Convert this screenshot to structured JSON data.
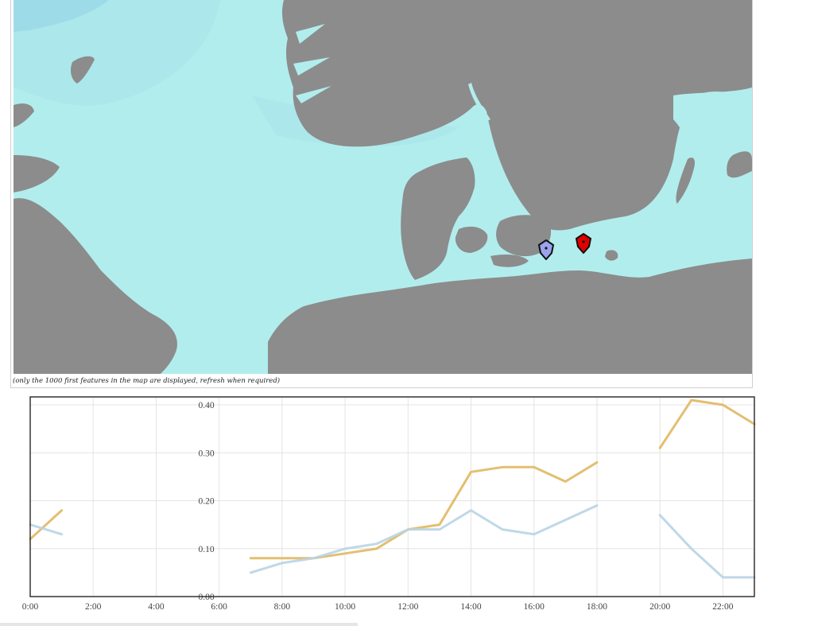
{
  "map": {
    "note": "(only the 1000 first features in the map are displayed, refresh when required)",
    "colors": {
      "sea": "#b2eded",
      "sea_shallow": "#a6e3ea",
      "sea_deep": "#8fcfe6",
      "land": "#8c8c8c",
      "marker_selected": "#e00000",
      "marker_other": "#9aa4ee"
    },
    "markers": [
      {
        "name": "station-marker-blue",
        "icon": "map-pin-icon",
        "color": "#9aa4ee"
      },
      {
        "name": "station-marker-red",
        "icon": "map-pin-icon",
        "color": "#e00000"
      }
    ]
  },
  "chart_data": {
    "type": "line",
    "x_unit": "hour of day",
    "x_ticks": [
      "0:00",
      "2:00",
      "4:00",
      "6:00",
      "8:00",
      "10:00",
      "12:00",
      "14:00",
      "16:00",
      "18:00",
      "20:00",
      "22:00"
    ],
    "y_ticks": [
      "0.00",
      "0.10",
      "0.20",
      "0.30",
      "0.40"
    ],
    "xlim": [
      0,
      23
    ],
    "ylim": [
      0,
      0.4
    ],
    "grid": true,
    "series": [
      {
        "color": "#e0b860",
        "values": [
          0.12,
          0.18,
          null,
          null,
          null,
          null,
          null,
          0.08,
          0.08,
          0.08,
          0.09,
          0.1,
          0.14,
          0.15,
          0.26,
          0.27,
          0.27,
          0.24,
          0.28,
          null,
          0.31,
          0.41,
          0.4,
          0.36
        ]
      },
      {
        "color": "#b8d4e4",
        "values": [
          0.15,
          0.13,
          null,
          null,
          null,
          null,
          null,
          0.05,
          0.07,
          0.08,
          0.1,
          0.11,
          0.14,
          0.14,
          0.18,
          0.14,
          0.13,
          0.16,
          0.19,
          null,
          0.17,
          0.1,
          0.04,
          0.04
        ]
      }
    ]
  }
}
